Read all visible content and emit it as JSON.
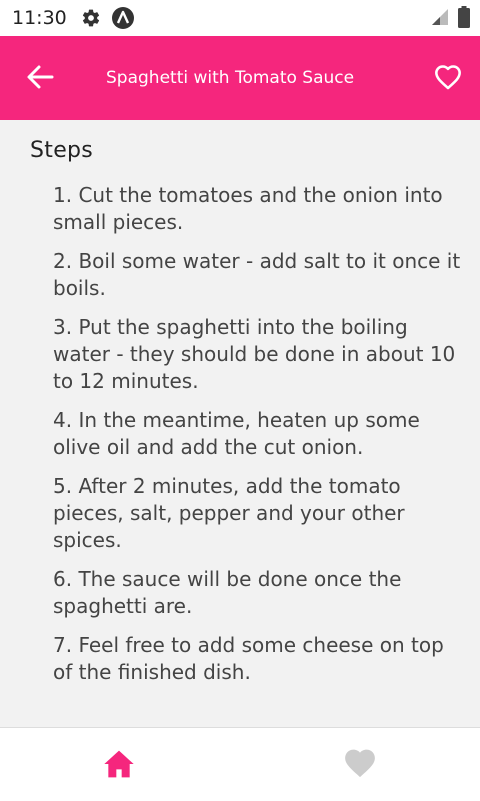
{
  "status_bar": {
    "time": "11:30",
    "icons": [
      "gear-icon",
      "a-logo-icon",
      "signal-icon",
      "battery-icon"
    ]
  },
  "app_bar": {
    "title": "Spaghetti with Tomato Sauce",
    "back_icon": "arrow-left-icon",
    "favorite_icon": "heart-outline-icon",
    "color": "#f5267d"
  },
  "content": {
    "heading": "Steps",
    "steps": [
      "1. Cut the tomatoes and the onion into small pieces.",
      "2. Boil some water - add salt to it once it boils.",
      "3. Put the spaghetti into the boiling water - they should be done in about 10 to 12 minutes.",
      "4. In the meantime, heaten up some olive oil and add the cut onion.",
      "5. After 2 minutes, add the tomato pieces, salt, pepper and your other spices.",
      "6. The sauce will be done once the spaghetti are.",
      "7. Feel free to add some cheese on top of the finished dish."
    ]
  },
  "bottom_nav": {
    "items": [
      {
        "icon": "home-icon",
        "active": true,
        "color": "#f5267d"
      },
      {
        "icon": "heart-icon",
        "active": false,
        "color": "#cccccc"
      }
    ]
  }
}
